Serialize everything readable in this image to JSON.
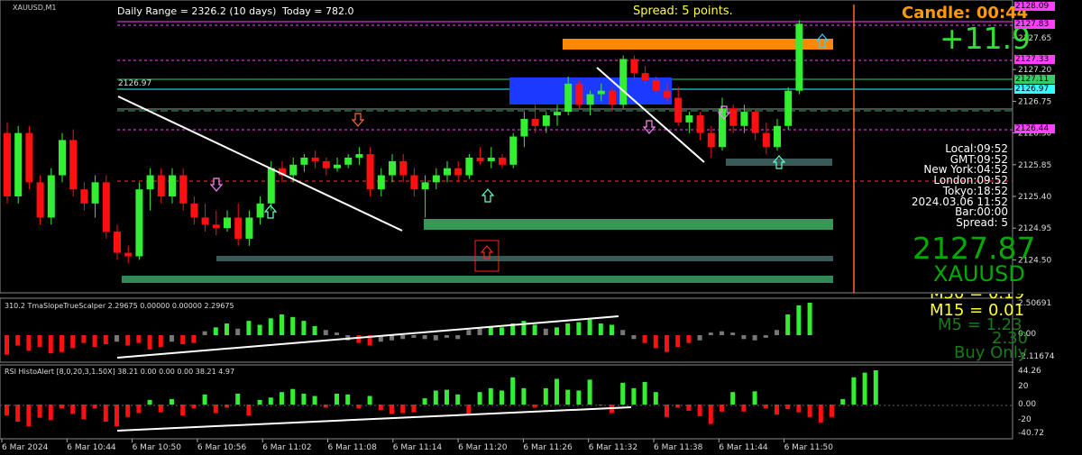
{
  "window": {
    "symbol_title": "XAUUSD,M1",
    "top_left_text": "XAUUSD,M1"
  },
  "header": {
    "daily_range": "Daily Range = 2326.2 (10 days)",
    "today": "Today = 782.0",
    "spread_text": "Spread: 5 points.",
    "candle_timer": "Candle:  00:44",
    "pnl": "+11.9"
  },
  "info_panel": {
    "local": "Local:09:52",
    "gmt": "GMT:09:52",
    "new_york": "New York:04:52",
    "london": "London:09:52",
    "tokyo": "Tokyo:18:52",
    "date": "2024.03.06 11:52",
    "bar": "Bar:00:00",
    "spread": "Spread:  5"
  },
  "big_price": "2127.87",
  "big_symbol": "XAUUSD",
  "level_label": "2126.97",
  "price_axis": {
    "ticks": [
      "2127.65",
      "2127.20",
      "2126.75",
      "2126.30",
      "2125.85",
      "2125.40",
      "2124.95",
      "2124.50"
    ],
    "boxes": [
      {
        "label": "2128.09",
        "color": "#ff40ff"
      },
      {
        "label": "2127.83",
        "color": "#ff40ff"
      },
      {
        "label": "2127.33",
        "color": "#ff40ff"
      },
      {
        "label": "2127.11",
        "color": "#33cc66"
      },
      {
        "label": "2126.97",
        "color": "#33ffff"
      },
      {
        "label": "2126.44",
        "color": "#ff40ff"
      }
    ]
  },
  "indicator1": {
    "title": "310.2 TmaSlopeTrueScalper 2.29675 0.00000 0.00000 2.29675",
    "ticks": [
      "2.50691",
      "0.00",
      "-2.11674"
    ],
    "mtf_top": "M30 = 0.19",
    "mtf_m15": "M15 = 0.01",
    "mtf_m5": "M5 = 1.23",
    "value": "2.30",
    "signal": "Buy Only"
  },
  "indicator2": {
    "title": "RSI HistoAlert [8,0,20,3,1.50X] 38.21 0.00 0.00 0.00 38.21 4.97",
    "ticks": [
      "44.26",
      "20",
      "0.00",
      "-20",
      "-40.72"
    ]
  },
  "time_axis": [
    "6 Mar 2024",
    "6 Mar 10:44",
    "6 Mar 10:50",
    "6 Mar 10:56",
    "6 Mar 11:02",
    "6 Mar 11:08",
    "6 Mar 11:14",
    "6 Mar 11:20",
    "6 Mar 11:26",
    "6 Mar 11:32",
    "6 Mar 11:38",
    "6 Mar 11:44",
    "6 Mar 11:50"
  ],
  "colors": {
    "bull": "#33ee33",
    "bear": "#ff1010",
    "bg": "#000000",
    "spread": "#ffff33",
    "candle_timer": "#ff9900",
    "pnl": "#33dd33",
    "big_price": "#00aa00"
  },
  "chart_data": {
    "type": "candlestick",
    "symbol": "XAUUSD",
    "timeframe": "M1",
    "ylim": [
      2124.3,
      2128.15
    ],
    "x": [
      "10:38",
      "10:39",
      "10:40",
      "10:41",
      "10:42",
      "10:43",
      "10:44",
      "10:45",
      "10:46",
      "10:47",
      "10:48",
      "10:49",
      "10:50",
      "10:51",
      "10:52",
      "10:53",
      "10:54",
      "10:55",
      "10:56",
      "10:57",
      "10:58",
      "10:59",
      "11:00",
      "11:01",
      "11:02",
      "11:03",
      "11:04",
      "11:05",
      "11:06",
      "11:07",
      "11:08",
      "11:09",
      "11:10",
      "11:11",
      "11:12",
      "11:13",
      "11:14",
      "11:15",
      "11:16",
      "11:17",
      "11:18",
      "11:19",
      "11:20",
      "11:21",
      "11:22",
      "11:23",
      "11:24",
      "11:25",
      "11:26",
      "11:27",
      "11:28",
      "11:29",
      "11:30",
      "11:31",
      "11:32",
      "11:33",
      "11:34",
      "11:35",
      "11:36",
      "11:37",
      "11:38",
      "11:39",
      "11:40",
      "11:41",
      "11:42",
      "11:43",
      "11:44",
      "11:45",
      "11:46",
      "11:47",
      "11:48",
      "11:49",
      "11:50"
    ],
    "ohlc": [
      [
        2126.3,
        2126.45,
        2125.3,
        2125.4
      ],
      [
        2125.4,
        2126.4,
        2125.3,
        2126.3
      ],
      [
        2126.3,
        2126.4,
        2125.5,
        2125.6
      ],
      [
        2125.6,
        2125.7,
        2125.0,
        2125.1
      ],
      [
        2125.1,
        2125.8,
        2125.0,
        2125.7
      ],
      [
        2125.7,
        2126.3,
        2125.6,
        2126.2
      ],
      [
        2126.2,
        2126.35,
        2125.4,
        2125.5
      ],
      [
        2125.5,
        2125.6,
        2125.2,
        2125.3
      ],
      [
        2125.3,
        2125.7,
        2125.1,
        2125.6
      ],
      [
        2125.6,
        2125.7,
        2124.8,
        2124.9
      ],
      [
        2124.9,
        2125.0,
        2124.5,
        2124.6
      ],
      [
        2124.6,
        2124.7,
        2124.45,
        2124.55
      ],
      [
        2124.55,
        2125.6,
        2124.5,
        2125.5
      ],
      [
        2125.5,
        2125.8,
        2125.2,
        2125.7
      ],
      [
        2125.7,
        2125.8,
        2125.3,
        2125.4
      ],
      [
        2125.4,
        2125.8,
        2125.3,
        2125.7
      ],
      [
        2125.7,
        2125.8,
        2125.2,
        2125.3
      ],
      [
        2125.3,
        2125.4,
        2125.0,
        2125.1
      ],
      [
        2125.1,
        2125.3,
        2124.9,
        2125.0
      ],
      [
        2125.0,
        2125.2,
        2124.85,
        2124.95
      ],
      [
        2124.95,
        2125.2,
        2124.9,
        2125.1
      ],
      [
        2125.1,
        2125.3,
        2124.7,
        2124.8
      ],
      [
        2124.8,
        2125.2,
        2124.7,
        2125.1
      ],
      [
        2125.1,
        2125.4,
        2125.0,
        2125.3
      ],
      [
        2125.3,
        2125.9,
        2125.2,
        2125.8
      ],
      [
        2125.8,
        2125.9,
        2125.6,
        2125.7
      ],
      [
        2125.7,
        2125.95,
        2125.6,
        2125.85
      ],
      [
        2125.85,
        2126.0,
        2125.75,
        2125.95
      ],
      [
        2125.95,
        2126.05,
        2125.8,
        2125.9
      ],
      [
        2125.9,
        2125.95,
        2125.7,
        2125.8
      ],
      [
        2125.8,
        2125.95,
        2125.75,
        2125.85
      ],
      [
        2125.85,
        2126.0,
        2125.8,
        2125.95
      ],
      [
        2125.95,
        2126.1,
        2125.85,
        2126.0
      ],
      [
        2126.0,
        2126.1,
        2125.4,
        2125.5
      ],
      [
        2125.5,
        2125.8,
        2125.4,
        2125.7
      ],
      [
        2125.7,
        2126.0,
        2125.6,
        2125.9
      ],
      [
        2125.9,
        2126.0,
        2125.6,
        2125.7
      ],
      [
        2125.7,
        2125.8,
        2125.4,
        2125.5
      ],
      [
        2125.5,
        2125.7,
        2125.1,
        2125.6
      ],
      [
        2125.6,
        2125.8,
        2125.5,
        2125.7
      ],
      [
        2125.7,
        2125.9,
        2125.6,
        2125.8
      ],
      [
        2125.8,
        2125.9,
        2125.6,
        2125.7
      ],
      [
        2125.7,
        2126.0,
        2125.65,
        2125.95
      ],
      [
        2125.95,
        2126.1,
        2125.85,
        2125.9
      ],
      [
        2125.9,
        2126.1,
        2125.8,
        2125.95
      ],
      [
        2125.95,
        2126.0,
        2125.8,
        2125.85
      ],
      [
        2125.85,
        2126.3,
        2125.8,
        2126.25
      ],
      [
        2126.25,
        2126.6,
        2126.1,
        2126.5
      ],
      [
        2126.5,
        2126.7,
        2126.3,
        2126.4
      ],
      [
        2126.4,
        2126.6,
        2126.3,
        2126.55
      ],
      [
        2126.55,
        2126.7,
        2126.4,
        2126.6
      ],
      [
        2126.6,
        2127.1,
        2126.55,
        2127.0
      ],
      [
        2127.0,
        2127.05,
        2126.65,
        2126.7
      ],
      [
        2126.7,
        2126.9,
        2126.55,
        2126.85
      ],
      [
        2126.85,
        2127.0,
        2126.75,
        2126.9
      ],
      [
        2126.9,
        2126.95,
        2126.6,
        2126.7
      ],
      [
        2126.7,
        2127.4,
        2126.65,
        2127.35
      ],
      [
        2127.35,
        2127.4,
        2127.05,
        2127.15
      ],
      [
        2127.15,
        2127.25,
        2127.0,
        2127.05
      ],
      [
        2127.05,
        2127.1,
        2126.85,
        2126.9
      ],
      [
        2126.9,
        2127.0,
        2126.75,
        2126.8
      ],
      [
        2126.8,
        2126.95,
        2126.4,
        2126.45
      ],
      [
        2126.45,
        2126.6,
        2126.3,
        2126.55
      ],
      [
        2126.55,
        2126.6,
        2126.2,
        2126.3
      ],
      [
        2126.3,
        2126.4,
        2125.95,
        2126.1
      ],
      [
        2126.1,
        2126.8,
        2126.05,
        2126.65
      ],
      [
        2126.65,
        2126.7,
        2126.3,
        2126.4
      ],
      [
        2126.4,
        2126.7,
        2126.3,
        2126.6
      ],
      [
        2126.6,
        2126.65,
        2126.2,
        2126.3
      ],
      [
        2126.3,
        2126.45,
        2126.0,
        2126.1
      ],
      [
        2126.1,
        2126.5,
        2126.05,
        2126.4
      ],
      [
        2126.4,
        2126.95,
        2126.35,
        2126.9
      ],
      [
        2126.9,
        2127.9,
        2126.85,
        2127.85
      ]
    ],
    "tma_slope": [
      -1.5,
      -0.8,
      -1.2,
      -0.9,
      -1.4,
      -1.3,
      -1.0,
      -0.6,
      -0.9,
      -0.7,
      -0.5,
      -0.8,
      -0.6,
      -1.1,
      -0.9,
      -0.5,
      -0.7,
      -0.6,
      0.3,
      0.6,
      0.9,
      0.5,
      1.1,
      0.8,
      1.3,
      1.6,
      1.4,
      1.1,
      0.7,
      0.4,
      0.2,
      -0.4,
      -0.6,
      -0.8,
      -0.5,
      -0.4,
      -0.3,
      -0.2,
      -0.3,
      -0.4,
      -0.2,
      -0.3,
      0.4,
      0.5,
      0.7,
      0.6,
      0.9,
      1.1,
      0.8,
      0.5,
      0.6,
      0.9,
      1.0,
      1.2,
      0.9,
      0.8,
      0.4,
      -0.3,
      -0.6,
      -1.0,
      -1.3,
      -0.9,
      -0.6,
      -0.4,
      0.2,
      0.3,
      0.2,
      -0.3,
      -0.4,
      -0.2,
      0.4,
      1.6,
      2.3,
      2.5
    ],
    "rsi_histo": [
      -14,
      -22,
      -28,
      -17,
      -20,
      -5,
      -12,
      -19,
      -5,
      -22,
      -28,
      -16,
      -11,
      6,
      -10,
      7,
      -14,
      -5,
      13,
      -11,
      -4,
      14,
      -14,
      6,
      9,
      16,
      20,
      14,
      11,
      -4,
      14,
      13,
      -5,
      11,
      -7,
      -12,
      -11,
      -10,
      8,
      18,
      19,
      13,
      -13,
      16,
      21,
      18,
      35,
      21,
      -4,
      21,
      33,
      19,
      18,
      32,
      -1,
      -11,
      28,
      21,
      29,
      16,
      -16,
      -4,
      -8,
      -15,
      -25,
      -9,
      16,
      -9,
      17,
      -5,
      -13,
      -6,
      -10,
      -16,
      -23,
      -16,
      7,
      35,
      41,
      44
    ]
  }
}
